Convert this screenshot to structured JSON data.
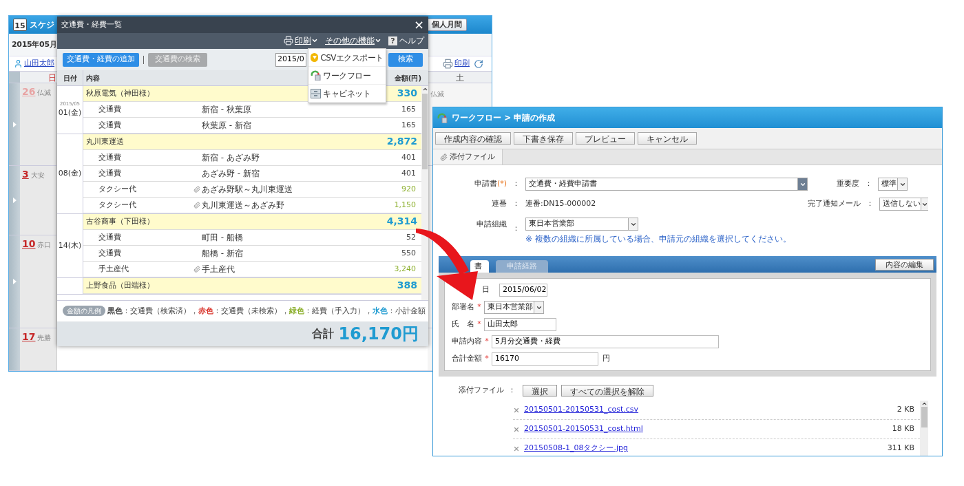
{
  "calendar": {
    "icon_text": "15",
    "title": "スケジ",
    "view_button": "個人月間",
    "month": "2015年05月",
    "user": "山田太郎",
    "print": "印刷",
    "sunday_header": "日",
    "saturday_header": "土",
    "saturday_rokuyo": "仏滅",
    "weeks": [
      {
        "day": "26",
        "rokuyo": "仏滅",
        "other_month": true
      },
      {
        "day": "3",
        "rokuyo": "大安",
        "other_month": false
      },
      {
        "day": "10",
        "rokuyo": "赤口",
        "other_month": false
      },
      {
        "day": "17",
        "rokuyo": "先勝",
        "other_month": false
      }
    ]
  },
  "expense_dialog": {
    "title": "交通費・経費一覧",
    "close": "×",
    "toolbar": [
      {
        "label": "印刷",
        "kind": "print"
      },
      {
        "label": "その他の機能",
        "kind": "menu"
      },
      {
        "label": "ヘルプ",
        "kind": "help",
        "icon_text": "?"
      }
    ],
    "add_button": "交通費・経費の追加",
    "search_tab": "交通費の検索",
    "date_value": "2015/0",
    "search_button": "検索",
    "menu": [
      {
        "label": "CSVエクスポート",
        "kind": "export"
      },
      {
        "label": "ワークフロー",
        "kind": "workflow"
      },
      {
        "label": "キャビネット",
        "kind": "cabinet"
      }
    ],
    "columns": [
      "日付",
      "内容",
      "金額(円)"
    ],
    "groups": [
      {
        "year": "2015/05",
        "date": "01(金)",
        "entries": [
          {
            "kind": "subtotal",
            "name": "秋原電気（神田様）",
            "amount": "330",
            "color": "#1f9bd1"
          },
          {
            "kind": "item",
            "category": "交通費",
            "detail": "新宿 - 秋葉原",
            "attachment": false,
            "amount": "165",
            "color": "#444444"
          },
          {
            "kind": "item",
            "category": "交通費",
            "detail": "秋葉原 - 新宿",
            "attachment": false,
            "amount": "165",
            "color": "#444444"
          }
        ]
      },
      {
        "date": "08(金)",
        "entries": [
          {
            "kind": "subtotal",
            "name": "丸川東運送",
            "amount": "2,872",
            "color": "#1f9bd1"
          },
          {
            "kind": "item",
            "category": "交通費",
            "detail": "新宿 - あざみ野",
            "attachment": false,
            "amount": "401",
            "color": "#444444"
          },
          {
            "kind": "item",
            "category": "交通費",
            "detail": "あざみ野 - 新宿",
            "attachment": false,
            "amount": "401",
            "color": "#444444"
          },
          {
            "kind": "item",
            "category": "タクシー代",
            "detail": "あざみ野駅～丸川東運送",
            "attachment": true,
            "amount": "920",
            "color": "#8db02f"
          },
          {
            "kind": "item",
            "category": "タクシー代",
            "detail": "丸川東運送～あざみ野",
            "attachment": true,
            "amount": "1,150",
            "color": "#8db02f"
          }
        ]
      },
      {
        "date": "14(木)",
        "entries": [
          {
            "kind": "subtotal",
            "name": "古谷商事（下田様）",
            "amount": "4,314",
            "color": "#1f9bd1"
          },
          {
            "kind": "item",
            "category": "交通費",
            "detail": "町田 - 船橋",
            "attachment": false,
            "amount": "52",
            "color": "#444444"
          },
          {
            "kind": "item",
            "category": "交通費",
            "detail": "船橋 - 新宿",
            "attachment": false,
            "amount": "550",
            "color": "#444444"
          },
          {
            "kind": "item",
            "category": "手土産代",
            "detail": "手土産代",
            "attachment": true,
            "amount": "3,240",
            "color": "#8db02f"
          }
        ]
      },
      {
        "entries": [
          {
            "kind": "subtotal",
            "name": "上野食品（田端様）",
            "amount": "388",
            "color": "#1f9bd1"
          }
        ]
      }
    ],
    "legend": {
      "badge": "金額の凡例",
      "items": [
        {
          "label": "黒色",
          "text": "：交通費（検索済），",
          "color": "#444444"
        },
        {
          "label": "赤色",
          "text": "：交通費（未検索），",
          "color": "#d9342b"
        },
        {
          "label": "緑色",
          "text": "：経費（手入力），",
          "color": "#8db02f"
        },
        {
          "label": "水色",
          "text": "：小計金額",
          "color": "#1f9bd1"
        }
      ]
    },
    "total": {
      "label": "合計",
      "value": "16,170円"
    }
  },
  "workflow_window": {
    "title": "ワークフロー > 申請の作成",
    "buttons": [
      "作成内容の確認",
      "下書き保存",
      "プレビュー",
      "キャンセル"
    ],
    "attach_tab": "添付ファイル",
    "separator": "：",
    "application": {
      "label": "申請書",
      "required": "(*)",
      "value": "交通費・経費申請書"
    },
    "serial": {
      "label": "連番",
      "value": "連番:DN15-000002"
    },
    "organization": {
      "label": "申請組織",
      "value": "東日本営業部",
      "note": "※ 複数の組織に所属している場合、申請元の組織を選択してください。"
    },
    "priority": {
      "label": "重要度",
      "value": "標準"
    },
    "notify": {
      "label": "完了通知メール",
      "value": "送信しない"
    },
    "tabs": [
      {
        "label": "書",
        "selected": true
      },
      {
        "label": "申請経路",
        "selected": false
      }
    ],
    "edit_button": "内容の編集",
    "required_mark": "*",
    "form": [
      {
        "label": "日",
        "value": "2015/06/02",
        "kind": "text",
        "required": false
      },
      {
        "label": "部署名",
        "value": "東日本営業部",
        "kind": "select",
        "required": true
      },
      {
        "label": "氏　名",
        "value": "山田太郎",
        "kind": "text",
        "required": true
      },
      {
        "label": "申請内容",
        "value": "5月分交通費・経費",
        "kind": "wide",
        "required": true
      },
      {
        "label": "合計金額",
        "value": "16170",
        "kind": "text",
        "required": true,
        "unit": "円"
      }
    ],
    "attachments": {
      "label": "添付ファイル",
      "buttons": [
        "選択",
        "すべての選択を解除"
      ],
      "files": [
        {
          "name": "20150501-20150531_cost.csv",
          "size": "2 KB"
        },
        {
          "name": "20150501-20150531_cost.html",
          "size": "18 KB"
        },
        {
          "name": "20150508-1_08タクシー.jpg",
          "size": "311 KB"
        }
      ]
    }
  }
}
